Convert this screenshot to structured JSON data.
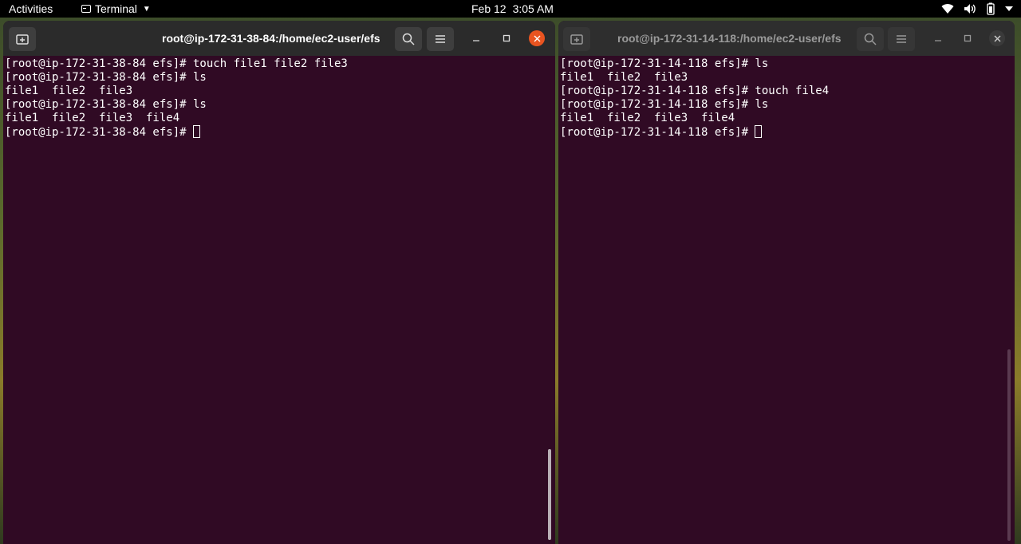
{
  "topbar": {
    "activities": "Activities",
    "app_name": "Terminal",
    "date": "Feb 12",
    "time": "3:05 AM",
    "icons": [
      "wifi-icon",
      "volume-icon",
      "battery-icon",
      "system-menu-chevron-icon"
    ]
  },
  "left_window": {
    "title": "root@ip-172-31-38-84:/home/ec2-user/efs",
    "lines": [
      "[root@ip-172-31-38-84 efs]# touch file1 file2 file3",
      "[root@ip-172-31-38-84 efs]# ls",
      "file1  file2  file3",
      "[root@ip-172-31-38-84 efs]# ls",
      "file1  file2  file3  file4"
    ],
    "prompt": "[root@ip-172-31-38-84 efs]# "
  },
  "right_window": {
    "title": "root@ip-172-31-14-118:/home/ec2-user/efs",
    "lines": [
      "[root@ip-172-31-14-118 efs]# ls",
      "file1  file2  file3",
      "[root@ip-172-31-14-118 efs]# touch file4",
      "[root@ip-172-31-14-118 efs]# ls",
      "file1  file2  file3  file4"
    ],
    "prompt": "[root@ip-172-31-14-118 efs]# "
  },
  "colors": {
    "terminal_bg": "#300a24",
    "titlebar_bg": "#2b2b2b",
    "close_accent": "#e95420"
  }
}
